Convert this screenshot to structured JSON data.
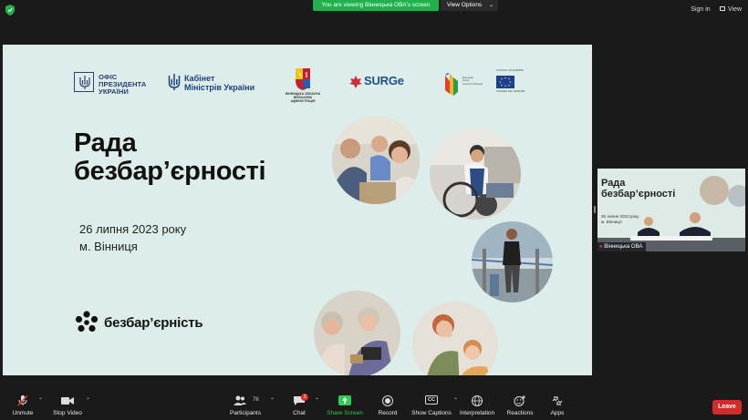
{
  "banner": {
    "share_text": "You are viewing Вінницька ОВА's screen",
    "view_options": "View Options"
  },
  "header": {
    "sign_in": "Sign in",
    "view": "View"
  },
  "slide": {
    "logos": {
      "ofis": [
        "ОФІС",
        "ПРЕЗИДЕНТА",
        "УКРАЇНИ"
      ],
      "kabinet": [
        "Кабінет",
        "Міністрів України"
      ],
      "vinn": [
        "ВІННИЦЬКА ОБЛАСНА",
        "ВІЙСЬКОВА АДМІНІСТРАЦІЯ"
      ],
      "surge": "SURGe",
      "coe_small": [
        "European",
        "Union",
        "Council of Europe"
      ],
      "coe_top": "COUNCIL OF EUROPE",
      "coe_bottom": "CONSEIL DE L'EUROPE"
    },
    "title_line1": "Рада",
    "title_line2": "безбар’єрності",
    "date": "26 липня 2023 року",
    "city": "м. Вінниця",
    "brand": "безбар’єрність"
  },
  "thumbnail": {
    "title_line1": "Рада",
    "title_line2": "безбар’єрності",
    "date": "26 липня 2023 року",
    "city": "м. Вінниця",
    "name": "Вінницька ОВА"
  },
  "toolbar": {
    "unmute": "Unmute",
    "stop_video": "Stop Video",
    "participants": "Participants",
    "participants_count": "76",
    "chat": "Chat",
    "chat_badge": "3",
    "share_screen": "Share Screen",
    "record": "Record",
    "show_captions": "Show Captions",
    "interpretation": "Interpretation",
    "reactions": "Reactions",
    "apps": "Apps",
    "leave": "Leave",
    "cc": "CC"
  },
  "colors": {
    "share_green": "#1fb14b",
    "leave_red": "#d22b2b",
    "slide_bg": "#ddeeea"
  }
}
